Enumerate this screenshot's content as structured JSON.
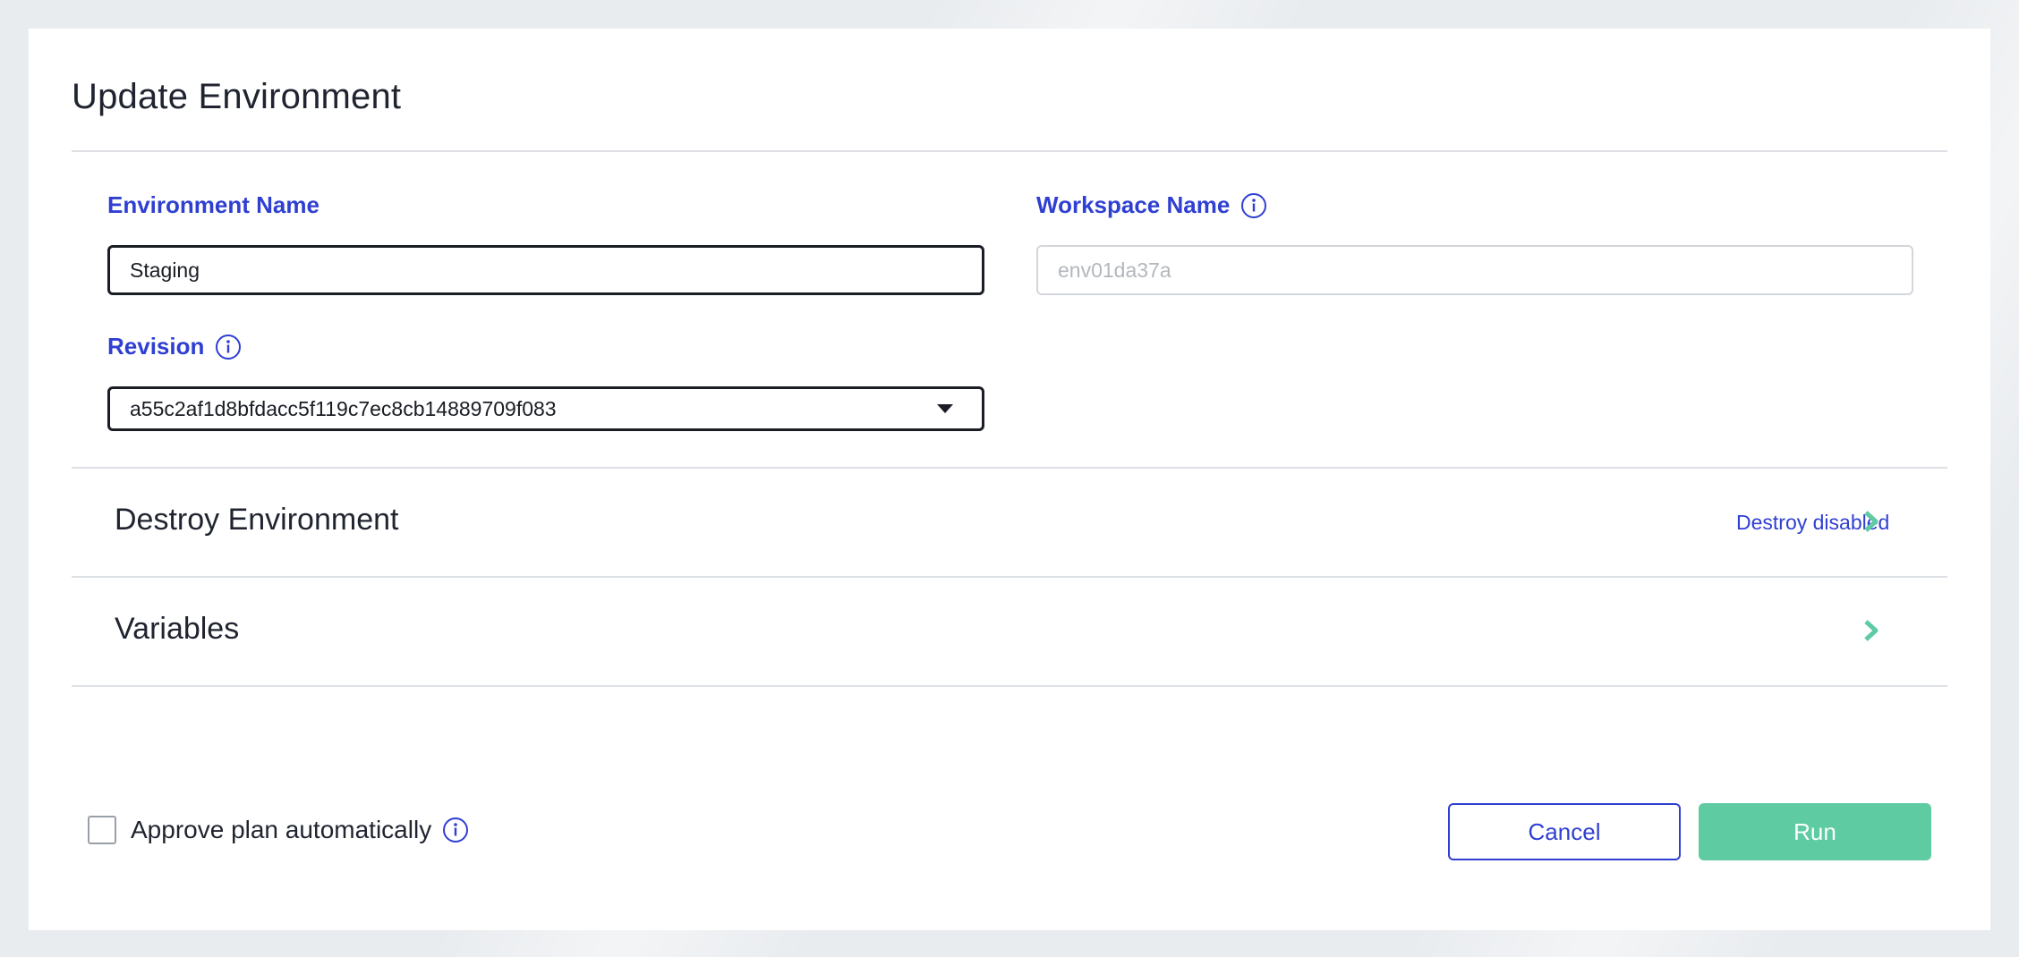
{
  "dialog": {
    "title": "Update Environment"
  },
  "form": {
    "environment_name": {
      "label": "Environment Name",
      "value": "Staging"
    },
    "workspace_name": {
      "label": "Workspace Name",
      "value": "env01da37a",
      "disabled": true
    },
    "revision": {
      "label": "Revision",
      "value": "a55c2af1d8bfdacc5f119c7ec8cb14889709f083"
    }
  },
  "sections": {
    "destroy": {
      "title": "Destroy Environment",
      "status": "Destroy disabled"
    },
    "variables": {
      "title": "Variables"
    }
  },
  "footer": {
    "approve_label": "Approve plan automatically",
    "approve_checked": false,
    "cancel_label": "Cancel",
    "run_label": "Run"
  },
  "colors": {
    "accent_blue": "#2f3fd1",
    "accent_green": "#5fcba3",
    "text_dark": "#1f2430",
    "divider": "#dde0e4"
  },
  "icons": {
    "info": "info-circle-icon",
    "dropdown": "caret-down-icon",
    "expand": "chevron-right-icon"
  }
}
